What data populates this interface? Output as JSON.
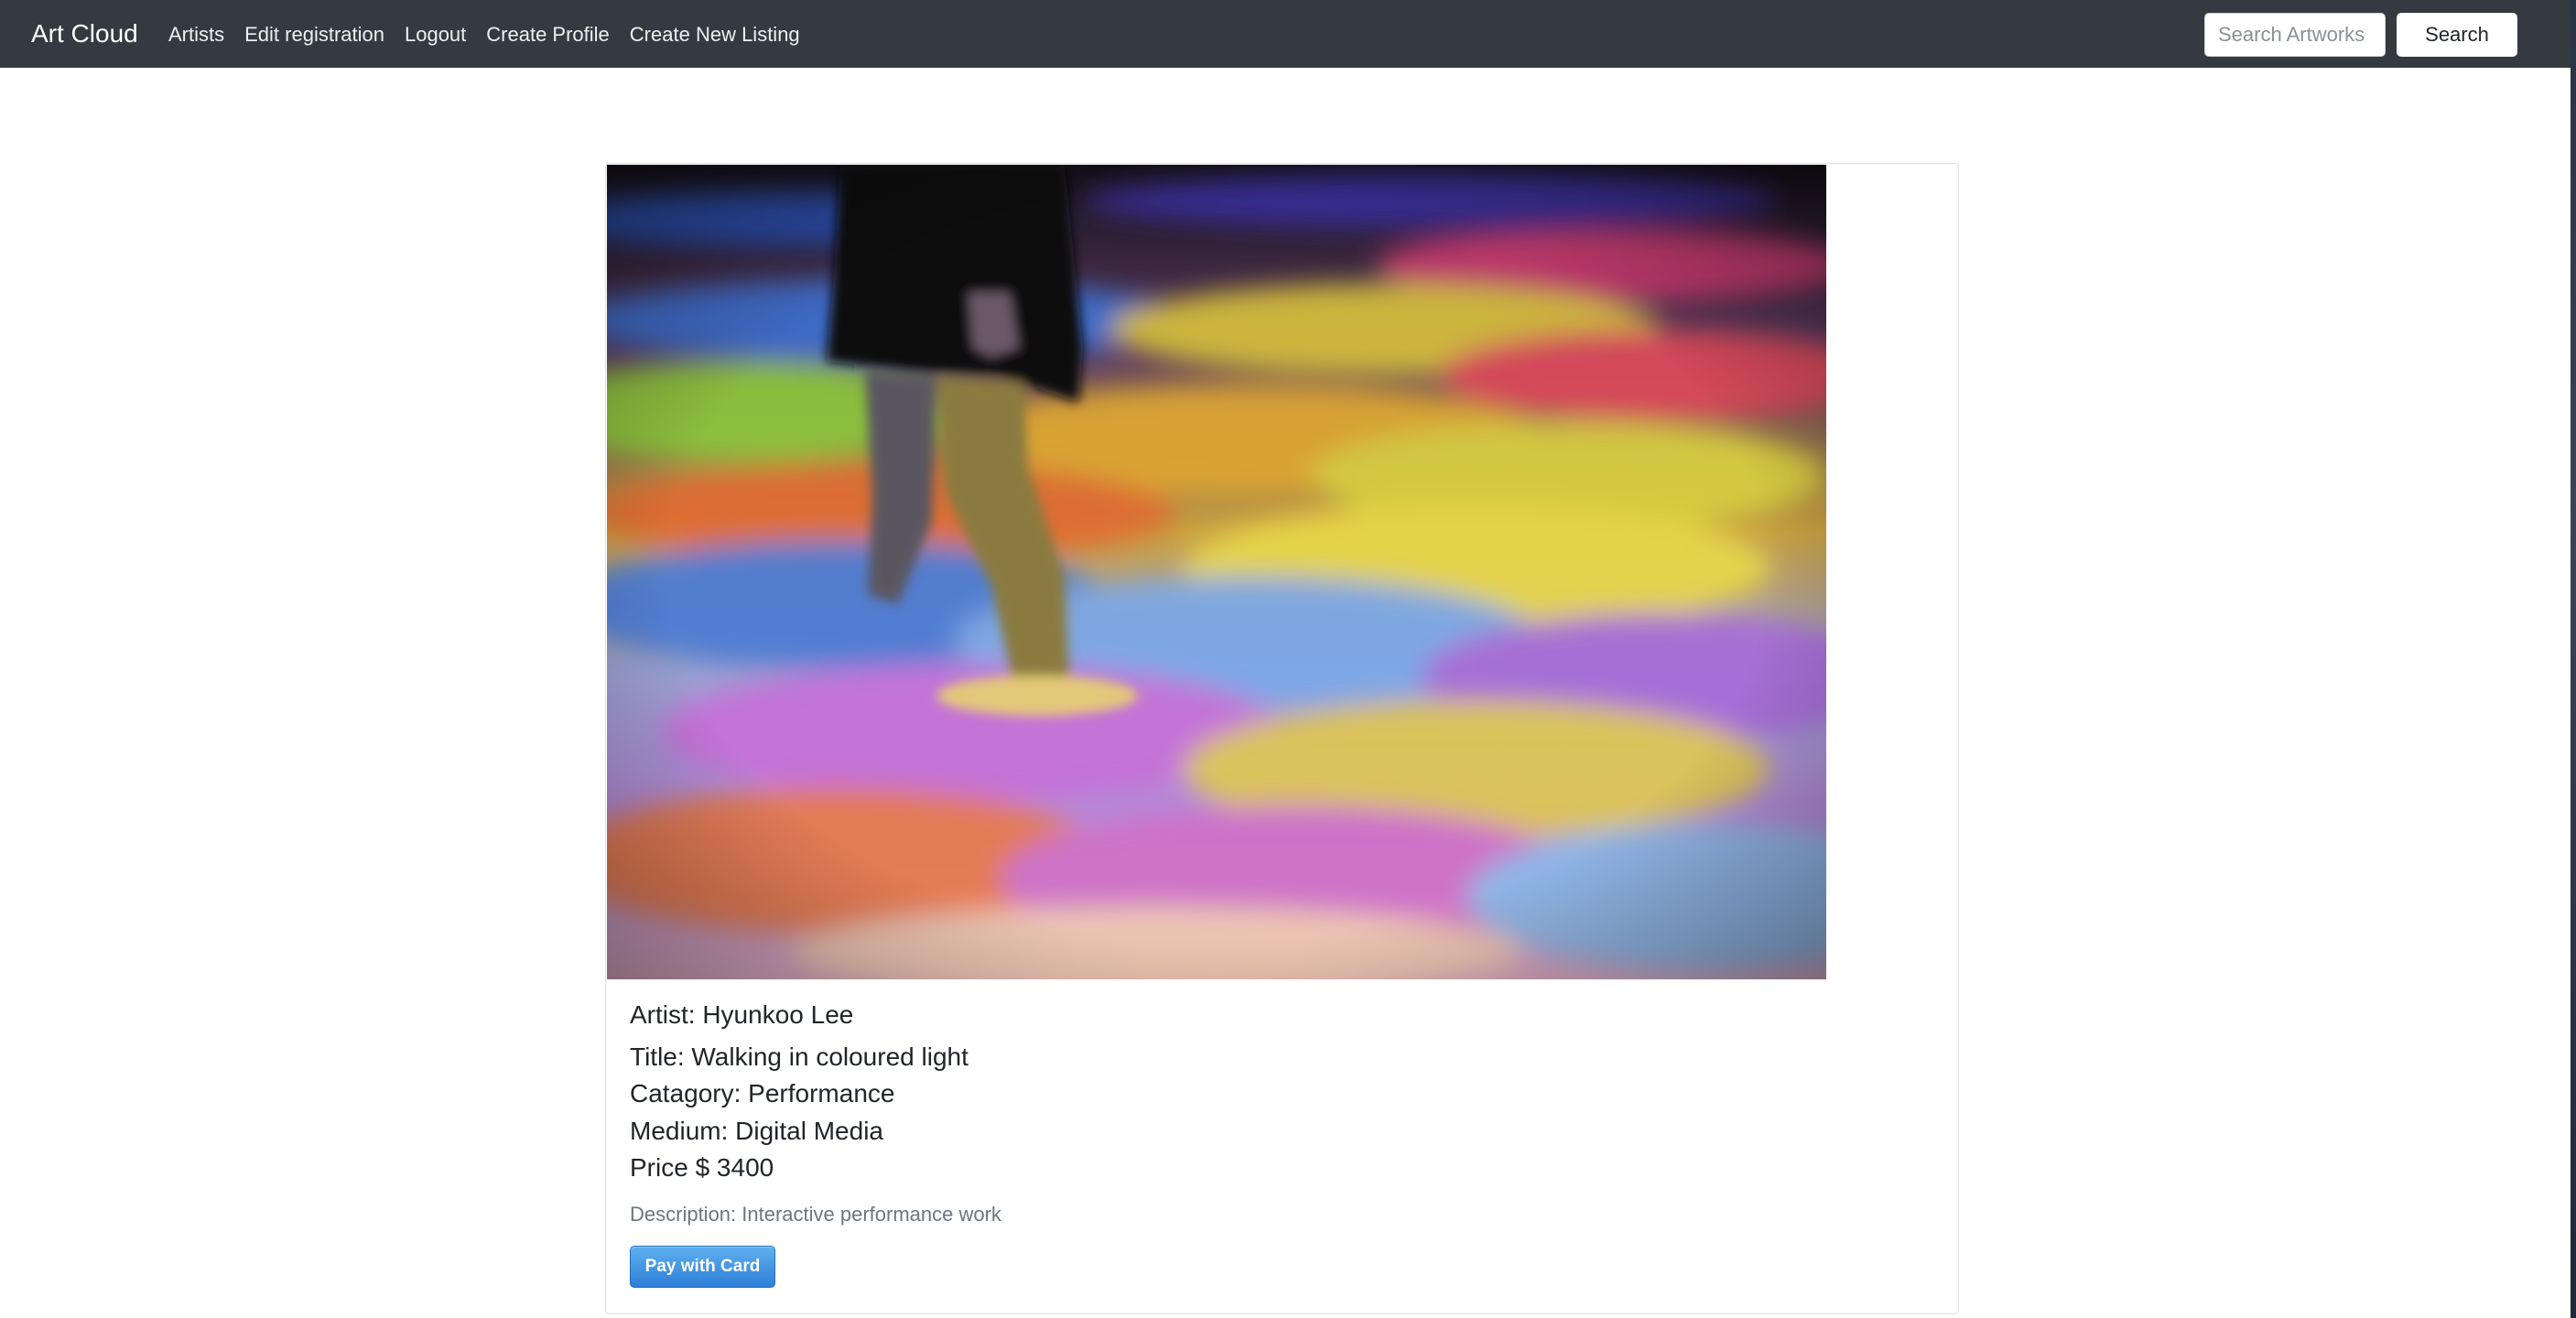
{
  "navbar": {
    "brand": "Art Cloud",
    "links": [
      "Artists",
      "Edit registration",
      "Logout",
      "Create Profile",
      "Create New Listing"
    ],
    "search_placeholder": "Search Artworks",
    "search_button": "Search"
  },
  "listing": {
    "artist": "Artist: Hyunkoo Lee",
    "title": "Title: Walking in coloured light",
    "category": "Catagory: Performance",
    "medium": "Medium: Digital Media",
    "price": "Price $ 3400",
    "description": "Description: Interactive performance work",
    "pay_button": "Pay with Card"
  },
  "colors": {
    "navbar_bg": "#343a40",
    "pay_button": "#2d7fd6",
    "muted_text": "#6c757d"
  }
}
